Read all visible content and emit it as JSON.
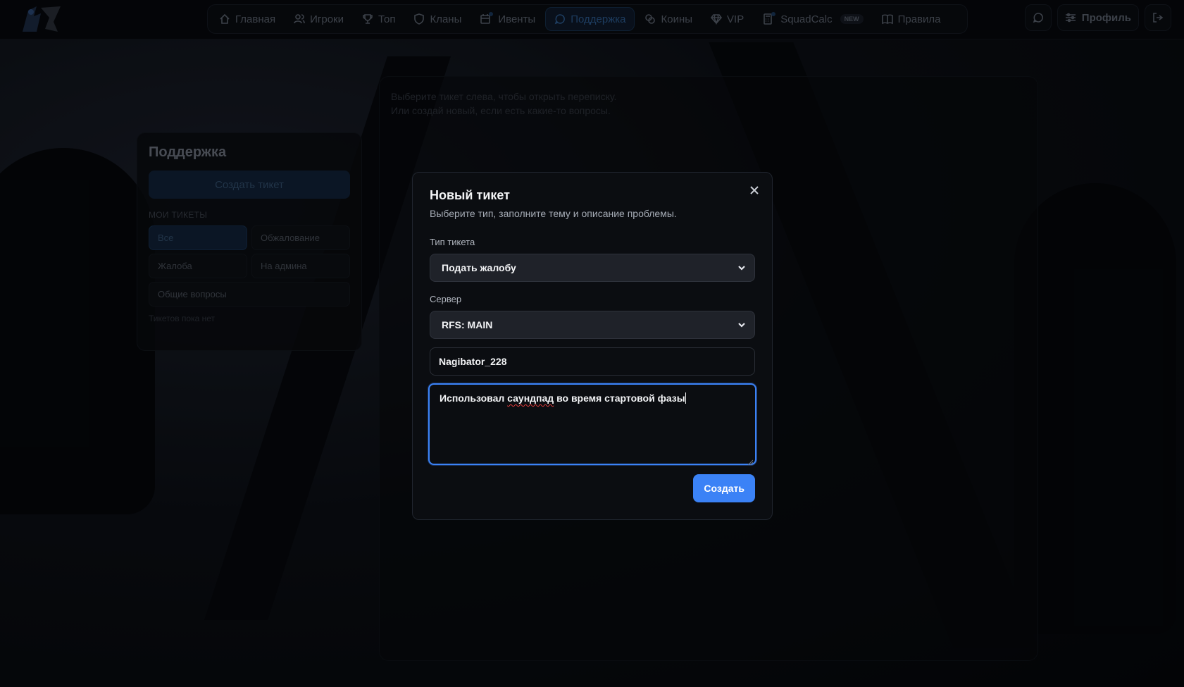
{
  "navbar": {
    "items": [
      {
        "label": "Главная",
        "icon": "home-icon"
      },
      {
        "label": "Игроки",
        "icon": "users-icon"
      },
      {
        "label": "Топ",
        "icon": "trophy-icon"
      },
      {
        "label": "Кланы",
        "icon": "shield-icon"
      },
      {
        "label": "Ивенты",
        "icon": "calendar-icon"
      },
      {
        "label": "Поддержка",
        "icon": "chat-icon",
        "active": true
      },
      {
        "label": "Коины",
        "icon": "coins-icon"
      },
      {
        "label": "VIP",
        "icon": "diamond-icon"
      },
      {
        "label": "SquadCalc",
        "icon": "calculator-icon",
        "badge": "NEW"
      },
      {
        "label": "Правила",
        "icon": "book-icon"
      }
    ],
    "profile_label": "Профиль"
  },
  "support": {
    "title": "Поддержка",
    "create_ticket_label": "Создать тикет",
    "my_tickets_label": "Мои тикеты",
    "filters": [
      "Все",
      "Обжалование",
      "Жалоба",
      "На админа",
      "Общие вопросы"
    ],
    "active_filter": "Все",
    "empty_note": "Тикетов пока нет"
  },
  "chat": {
    "hint_line1": "Выберите тикет слева, чтобы открыть переписку.",
    "hint_line2": "Или создай новый, если есть какие-то вопросы."
  },
  "modal": {
    "title": "Новый тикет",
    "subtitle": "Выберите тип, заполните тему и описание проблемы.",
    "ticket_type_label": "Тип тикета",
    "ticket_type_value": "Подать жалобу",
    "server_label": "Сервер",
    "server_value": "RFS: MAIN",
    "nickname_value": "Nagibator_228",
    "description_before": "Использовал ",
    "description_misspelled": "саундпад",
    "description_after": " во время стартовой фазы",
    "submit_label": "Создать"
  },
  "colors": {
    "accent": "#3b82f6",
    "modal_bg": "#0b0d11",
    "page_bg": "#05070a"
  }
}
